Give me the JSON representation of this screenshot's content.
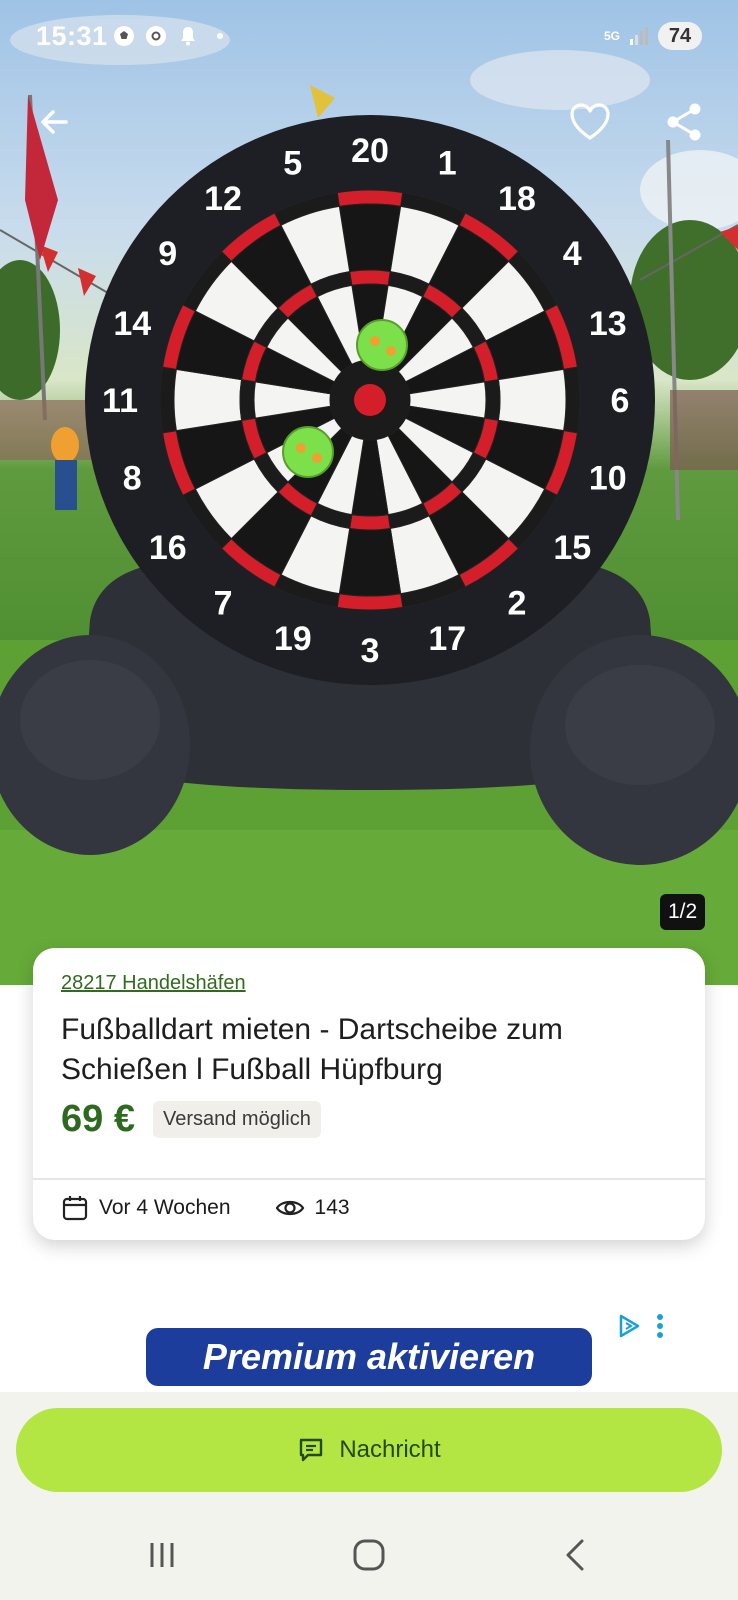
{
  "status_bar": {
    "time": "15:31",
    "network": "5G",
    "battery": "74"
  },
  "image": {
    "counter": "1/2",
    "numbers": [
      "20",
      "1",
      "18",
      "4",
      "13",
      "6",
      "10",
      "15",
      "2",
      "17",
      "3",
      "19",
      "7",
      "16",
      "8",
      "11",
      "14",
      "9",
      "12",
      "5"
    ]
  },
  "listing": {
    "location": "28217 Handelshäfen",
    "title": "Fußballdart mieten - Dartscheibe zum Schießen l Fußball Hüpfburg",
    "price": "69 €",
    "shipping": "Versand möglich",
    "posted": "Vor 4 Wochen",
    "views": "143"
  },
  "ad": {
    "banner_text": "Premium aktivieren"
  },
  "actions": {
    "message_label": "Nachricht"
  },
  "colors": {
    "accent_green": "#b3e543",
    "price_green": "#2d6a1f",
    "ad_blue": "#1c3d9b"
  }
}
